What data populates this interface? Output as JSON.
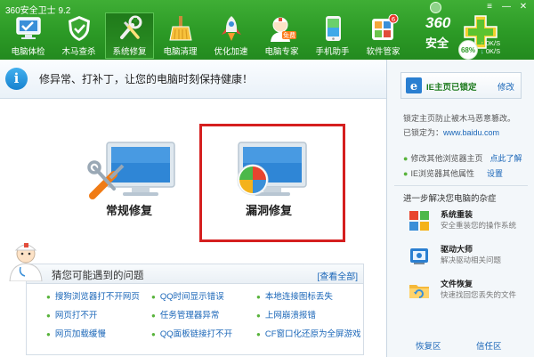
{
  "window": {
    "title": "360安全卫士 9.2"
  },
  "nav": {
    "tabs": [
      {
        "label": "电脑体检",
        "icon": "pc-check-icon"
      },
      {
        "label": "木马查杀",
        "icon": "shield-trojan-icon"
      },
      {
        "label": "系统修复",
        "icon": "tools-repair-icon",
        "active": true
      },
      {
        "label": "电脑清理",
        "icon": "broom-clean-icon"
      },
      {
        "label": "优化加速",
        "icon": "rocket-icon"
      },
      {
        "label": "电脑专家",
        "icon": "doctor-icon",
        "badge": "免费"
      },
      {
        "label": "手机助手",
        "icon": "phone-icon"
      },
      {
        "label": "软件管家",
        "icon": "app-store-icon",
        "badge": "6"
      }
    ]
  },
  "brand": {
    "logo_text": "360",
    "sub_text": "安全",
    "network_percent": "68%",
    "upload_speed": "0K/S",
    "download_speed": "0K/S"
  },
  "notice": {
    "text": "修异常、打补丁，让您的电脑时刻保持健康！"
  },
  "main": {
    "general_repair_label": "常规修复",
    "vulnerability_repair_label": "漏洞修复"
  },
  "faq": {
    "title": "猜您可能遇到的问题",
    "view_all": "[查看全部]",
    "items": [
      "搜狗浏览器打不开网页",
      "QQ时间显示错误",
      "本地连接图标丢失",
      "网页打不开",
      "任务管理器异常",
      "上网崩溃报错",
      "网页加载缓慢",
      "QQ面板链接打不开",
      "CF窗口化还原为全屏游戏"
    ]
  },
  "sidebar": {
    "ie_status": "IE主页已锁定",
    "ie_modify": "修改",
    "lock_desc_line1": "锁定主页防止被木马恶意篡改。",
    "lock_desc_prefix": "已锁定为：",
    "lock_url": "www.baidu.com",
    "option1_text": "修改其他浏览器主页",
    "option1_link": "点此了解",
    "option2_text": "IE浏览器其他属性",
    "option2_link": "设置",
    "next_title": "进一步解决您电脑的杂症",
    "tools": [
      {
        "name": "系统重装",
        "desc": "安全重装您的操作系统",
        "icon": "system-reinstall-icon"
      },
      {
        "name": "驱动大师",
        "desc": "解决驱动相关问题",
        "icon": "driver-master-icon"
      },
      {
        "name": "文件恢复",
        "desc": "快速找回您丢失的文件",
        "icon": "file-recovery-icon"
      }
    ],
    "bottom_left": "恢复区",
    "bottom_right": "信任区"
  },
  "colors": {
    "header_green": "#2c9a26",
    "link_blue": "#1a66b8",
    "highlight_red": "#d51f1f"
  }
}
